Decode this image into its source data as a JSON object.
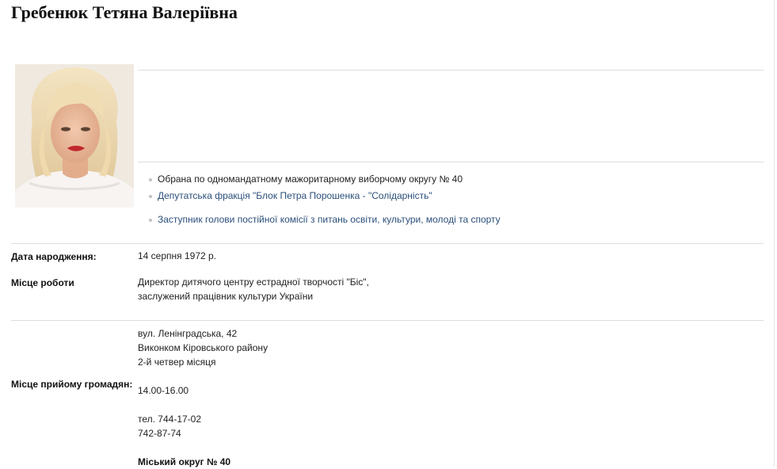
{
  "person": {
    "name": "Гребенюк Тетяна Валеріївна"
  },
  "summary": {
    "items": [
      "Обрана по одномандатному мажоритарному виборчому округу № 40",
      "Депутатська фракція \"Блок Петра Порошенка - \"Солідарність\"",
      "Заступник голови постійної комісії з питань освіти, культури, молоді та спорту"
    ]
  },
  "details": {
    "birth_label": "Дата народження:",
    "birth_value": "14 серпня 1972 р.",
    "work_label": "Місце роботи",
    "work_lines": [
      "Директор дитячого центру естрадної творчості \"Біс\",",
      "заслужений працівник культури України"
    ],
    "reception_label": "Місце прийому громадян:",
    "reception_lines": [
      "вул. Ленінградська, 42",
      "Виконком Кіровського району",
      "2-й четвер місяця",
      "14.00-16.00",
      "тел. 744-17-02",
      "742-87-74",
      "Міський округ № 40"
    ]
  }
}
